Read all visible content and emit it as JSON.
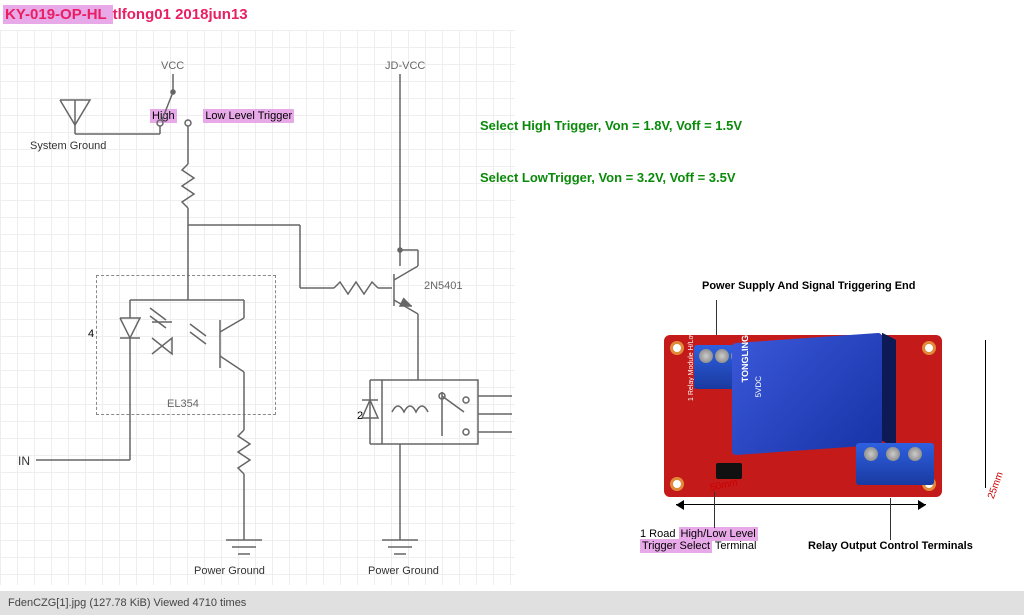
{
  "title_prefix": "KY-019-OP-HL ",
  "title_rest": "tlfong01 2018jun13",
  "switch": {
    "high": "High",
    "low": "Low Level Trigger"
  },
  "labels": {
    "vcc": "VCC",
    "jdvcc": "JD-VCC",
    "sysgnd": "System Ground",
    "pwrgnd1": "Power Ground",
    "pwrgnd2": "Power Ground",
    "in": "IN",
    "opto": "EL354",
    "transistor": "2N5401",
    "pin4": "4",
    "pin2": "2"
  },
  "notes": {
    "hi": "Select High Trigger, Von = 1.8V, Voff = 1.5V",
    "lo": "Select LowTrigger, Von = 3.2V, Voff = 3.5V"
  },
  "relay_captions": {
    "top": "Power Supply And Signal Triggering End",
    "bottom_left_1": "1 Road ",
    "bottom_left_hl": "High/Low Level",
    "bottom_left_2": "Trigger Select",
    " bottom_left_3": " Terminal",
    "bottom_right": "Relay Output Control Terminals"
  },
  "relay_text": {
    "brand": "TONGLING",
    "spec": "5VDC",
    "silk": "1 Relay Module H/Low Level Trigger"
  },
  "dimensions": {
    "w": "50mm",
    "h": "25mm"
  },
  "attachment": {
    "name": "FdenCZG[1].jpg",
    "size": "127.78 KiB",
    "views": "4710"
  }
}
